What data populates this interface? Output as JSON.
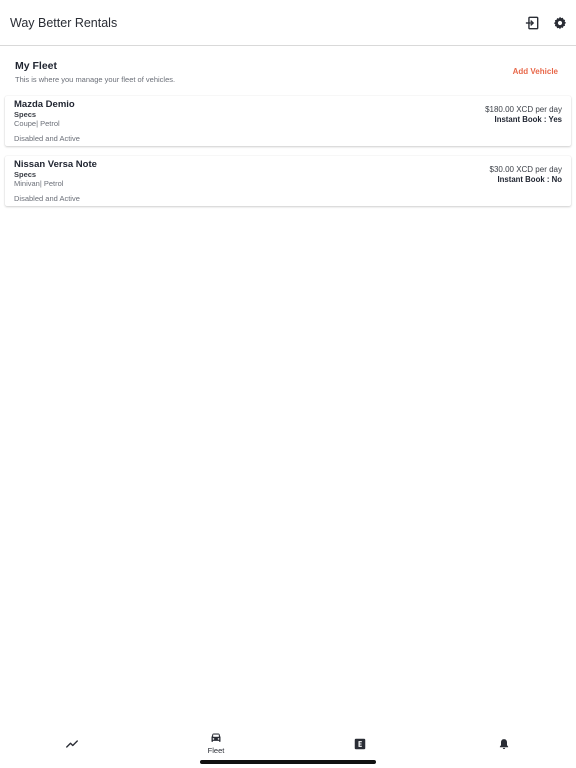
{
  "header": {
    "title": "Way Better Rentals",
    "logout_icon": "logout-icon",
    "settings_icon": "gear-icon"
  },
  "fleet": {
    "title": "My Fleet",
    "subtitle": "This is where you manage your fleet of vehicles.",
    "add_vehicle_label": "Add Vehicle"
  },
  "vehicles": [
    {
      "name": "Mazda Demio",
      "specs_label": "Specs",
      "specs": "Coupe| Petrol",
      "status": "Disabled and Active",
      "price": "$180.00 XCD per day",
      "instant_book": "Instant Book : Yes"
    },
    {
      "name": "Nissan Versa Note",
      "specs_label": "Specs",
      "specs": "Minivan| Petrol",
      "status": "Disabled and Active",
      "price": "$30.00 XCD per day",
      "instant_book": "Instant Book : No"
    }
  ],
  "bottom_nav": {
    "items": [
      {
        "icon": "trend-icon",
        "label": ""
      },
      {
        "icon": "car-icon",
        "label": "Fleet"
      },
      {
        "icon": "e-square-icon",
        "label": ""
      },
      {
        "icon": "bell-icon",
        "label": ""
      }
    ]
  },
  "colors": {
    "accent": "#e8684a",
    "text_primary": "#1f2430",
    "text_secondary": "#6b6f78",
    "divider": "#d9d9d9"
  }
}
